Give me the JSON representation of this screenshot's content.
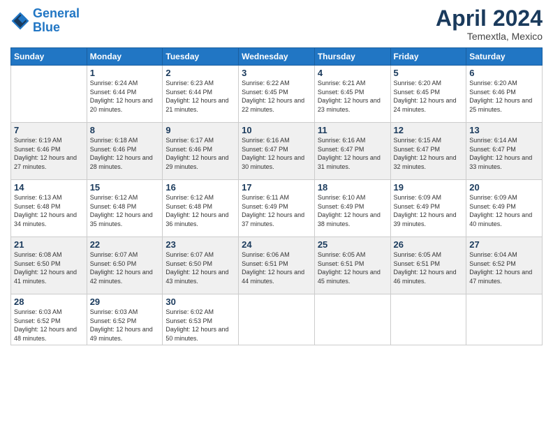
{
  "header": {
    "logo_line1": "General",
    "logo_line2": "Blue",
    "month": "April 2024",
    "location": "Temextla, Mexico"
  },
  "days_of_week": [
    "Sunday",
    "Monday",
    "Tuesday",
    "Wednesday",
    "Thursday",
    "Friday",
    "Saturday"
  ],
  "weeks": [
    [
      {
        "day": "",
        "sunrise": "",
        "sunset": "",
        "daylight": ""
      },
      {
        "day": "1",
        "sunrise": "Sunrise: 6:24 AM",
        "sunset": "Sunset: 6:44 PM",
        "daylight": "Daylight: 12 hours and 20 minutes."
      },
      {
        "day": "2",
        "sunrise": "Sunrise: 6:23 AM",
        "sunset": "Sunset: 6:44 PM",
        "daylight": "Daylight: 12 hours and 21 minutes."
      },
      {
        "day": "3",
        "sunrise": "Sunrise: 6:22 AM",
        "sunset": "Sunset: 6:45 PM",
        "daylight": "Daylight: 12 hours and 22 minutes."
      },
      {
        "day": "4",
        "sunrise": "Sunrise: 6:21 AM",
        "sunset": "Sunset: 6:45 PM",
        "daylight": "Daylight: 12 hours and 23 minutes."
      },
      {
        "day": "5",
        "sunrise": "Sunrise: 6:20 AM",
        "sunset": "Sunset: 6:45 PM",
        "daylight": "Daylight: 12 hours and 24 minutes."
      },
      {
        "day": "6",
        "sunrise": "Sunrise: 6:20 AM",
        "sunset": "Sunset: 6:46 PM",
        "daylight": "Daylight: 12 hours and 25 minutes."
      }
    ],
    [
      {
        "day": "7",
        "sunrise": "Sunrise: 6:19 AM",
        "sunset": "Sunset: 6:46 PM",
        "daylight": "Daylight: 12 hours and 27 minutes."
      },
      {
        "day": "8",
        "sunrise": "Sunrise: 6:18 AM",
        "sunset": "Sunset: 6:46 PM",
        "daylight": "Daylight: 12 hours and 28 minutes."
      },
      {
        "day": "9",
        "sunrise": "Sunrise: 6:17 AM",
        "sunset": "Sunset: 6:46 PM",
        "daylight": "Daylight: 12 hours and 29 minutes."
      },
      {
        "day": "10",
        "sunrise": "Sunrise: 6:16 AM",
        "sunset": "Sunset: 6:47 PM",
        "daylight": "Daylight: 12 hours and 30 minutes."
      },
      {
        "day": "11",
        "sunrise": "Sunrise: 6:16 AM",
        "sunset": "Sunset: 6:47 PM",
        "daylight": "Daylight: 12 hours and 31 minutes."
      },
      {
        "day": "12",
        "sunrise": "Sunrise: 6:15 AM",
        "sunset": "Sunset: 6:47 PM",
        "daylight": "Daylight: 12 hours and 32 minutes."
      },
      {
        "day": "13",
        "sunrise": "Sunrise: 6:14 AM",
        "sunset": "Sunset: 6:47 PM",
        "daylight": "Daylight: 12 hours and 33 minutes."
      }
    ],
    [
      {
        "day": "14",
        "sunrise": "Sunrise: 6:13 AM",
        "sunset": "Sunset: 6:48 PM",
        "daylight": "Daylight: 12 hours and 34 minutes."
      },
      {
        "day": "15",
        "sunrise": "Sunrise: 6:12 AM",
        "sunset": "Sunset: 6:48 PM",
        "daylight": "Daylight: 12 hours and 35 minutes."
      },
      {
        "day": "16",
        "sunrise": "Sunrise: 6:12 AM",
        "sunset": "Sunset: 6:48 PM",
        "daylight": "Daylight: 12 hours and 36 minutes."
      },
      {
        "day": "17",
        "sunrise": "Sunrise: 6:11 AM",
        "sunset": "Sunset: 6:49 PM",
        "daylight": "Daylight: 12 hours and 37 minutes."
      },
      {
        "day": "18",
        "sunrise": "Sunrise: 6:10 AM",
        "sunset": "Sunset: 6:49 PM",
        "daylight": "Daylight: 12 hours and 38 minutes."
      },
      {
        "day": "19",
        "sunrise": "Sunrise: 6:09 AM",
        "sunset": "Sunset: 6:49 PM",
        "daylight": "Daylight: 12 hours and 39 minutes."
      },
      {
        "day": "20",
        "sunrise": "Sunrise: 6:09 AM",
        "sunset": "Sunset: 6:49 PM",
        "daylight": "Daylight: 12 hours and 40 minutes."
      }
    ],
    [
      {
        "day": "21",
        "sunrise": "Sunrise: 6:08 AM",
        "sunset": "Sunset: 6:50 PM",
        "daylight": "Daylight: 12 hours and 41 minutes."
      },
      {
        "day": "22",
        "sunrise": "Sunrise: 6:07 AM",
        "sunset": "Sunset: 6:50 PM",
        "daylight": "Daylight: 12 hours and 42 minutes."
      },
      {
        "day": "23",
        "sunrise": "Sunrise: 6:07 AM",
        "sunset": "Sunset: 6:50 PM",
        "daylight": "Daylight: 12 hours and 43 minutes."
      },
      {
        "day": "24",
        "sunrise": "Sunrise: 6:06 AM",
        "sunset": "Sunset: 6:51 PM",
        "daylight": "Daylight: 12 hours and 44 minutes."
      },
      {
        "day": "25",
        "sunrise": "Sunrise: 6:05 AM",
        "sunset": "Sunset: 6:51 PM",
        "daylight": "Daylight: 12 hours and 45 minutes."
      },
      {
        "day": "26",
        "sunrise": "Sunrise: 6:05 AM",
        "sunset": "Sunset: 6:51 PM",
        "daylight": "Daylight: 12 hours and 46 minutes."
      },
      {
        "day": "27",
        "sunrise": "Sunrise: 6:04 AM",
        "sunset": "Sunset: 6:52 PM",
        "daylight": "Daylight: 12 hours and 47 minutes."
      }
    ],
    [
      {
        "day": "28",
        "sunrise": "Sunrise: 6:03 AM",
        "sunset": "Sunset: 6:52 PM",
        "daylight": "Daylight: 12 hours and 48 minutes."
      },
      {
        "day": "29",
        "sunrise": "Sunrise: 6:03 AM",
        "sunset": "Sunset: 6:52 PM",
        "daylight": "Daylight: 12 hours and 49 minutes."
      },
      {
        "day": "30",
        "sunrise": "Sunrise: 6:02 AM",
        "sunset": "Sunset: 6:53 PM",
        "daylight": "Daylight: 12 hours and 50 minutes."
      },
      {
        "day": "",
        "sunrise": "",
        "sunset": "",
        "daylight": ""
      },
      {
        "day": "",
        "sunrise": "",
        "sunset": "",
        "daylight": ""
      },
      {
        "day": "",
        "sunrise": "",
        "sunset": "",
        "daylight": ""
      },
      {
        "day": "",
        "sunrise": "",
        "sunset": "",
        "daylight": ""
      }
    ]
  ]
}
